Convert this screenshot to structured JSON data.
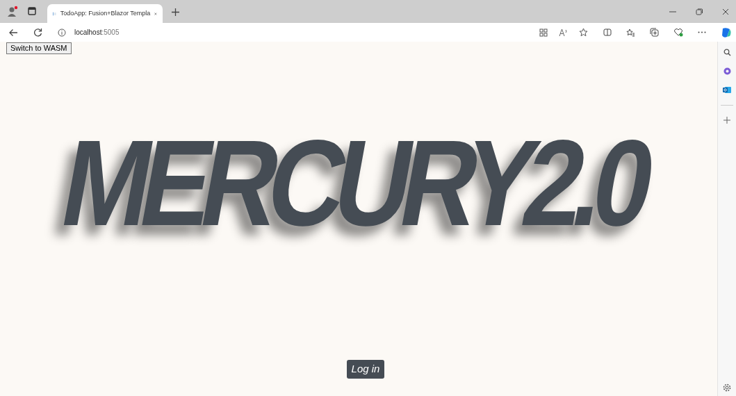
{
  "browser": {
    "tabs": [
      {
        "title": "TodoApp: Fusion+Blazor Templa",
        "selected": true
      }
    ],
    "address": {
      "host": "localhost",
      "port": ":5005"
    }
  },
  "page": {
    "switch_button": "Switch to WASM",
    "logo": "MERCURY2.0",
    "login_button": "Log in"
  }
}
